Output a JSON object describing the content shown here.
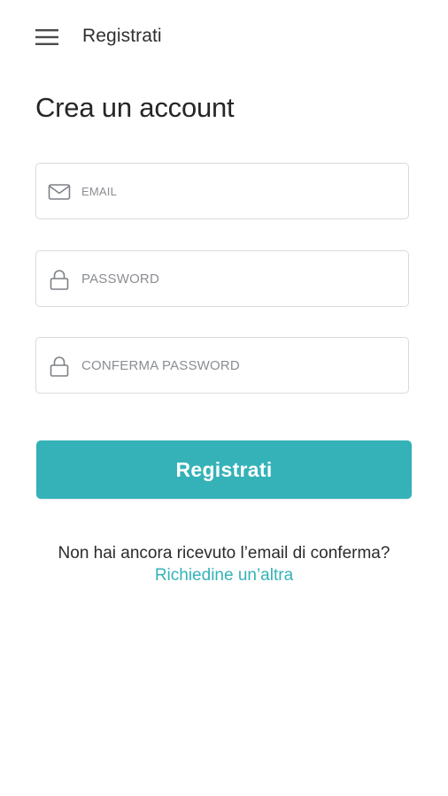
{
  "header": {
    "menu_icon": "hamburger-menu-icon",
    "title": "Registrati"
  },
  "page": {
    "title": "Crea un account"
  },
  "form": {
    "email": {
      "icon": "envelope-icon",
      "placeholder": "EMAIL",
      "value": ""
    },
    "password": {
      "icon": "lock-icon",
      "placeholder": "PASSWORD",
      "value": ""
    },
    "confirm_password": {
      "icon": "lock-icon",
      "placeholder": "CONFERMA PASSWORD",
      "value": ""
    },
    "submit_label": "Registrati"
  },
  "resend": {
    "question": "Non hai ancora ricevuto l’email di conferma?",
    "link_label": "Richiedine un’altra"
  },
  "colors": {
    "accent": "#34b2b8",
    "field_border": "#d9dadc",
    "placeholder": "#8a8d92",
    "text": "#2b2b2b"
  }
}
